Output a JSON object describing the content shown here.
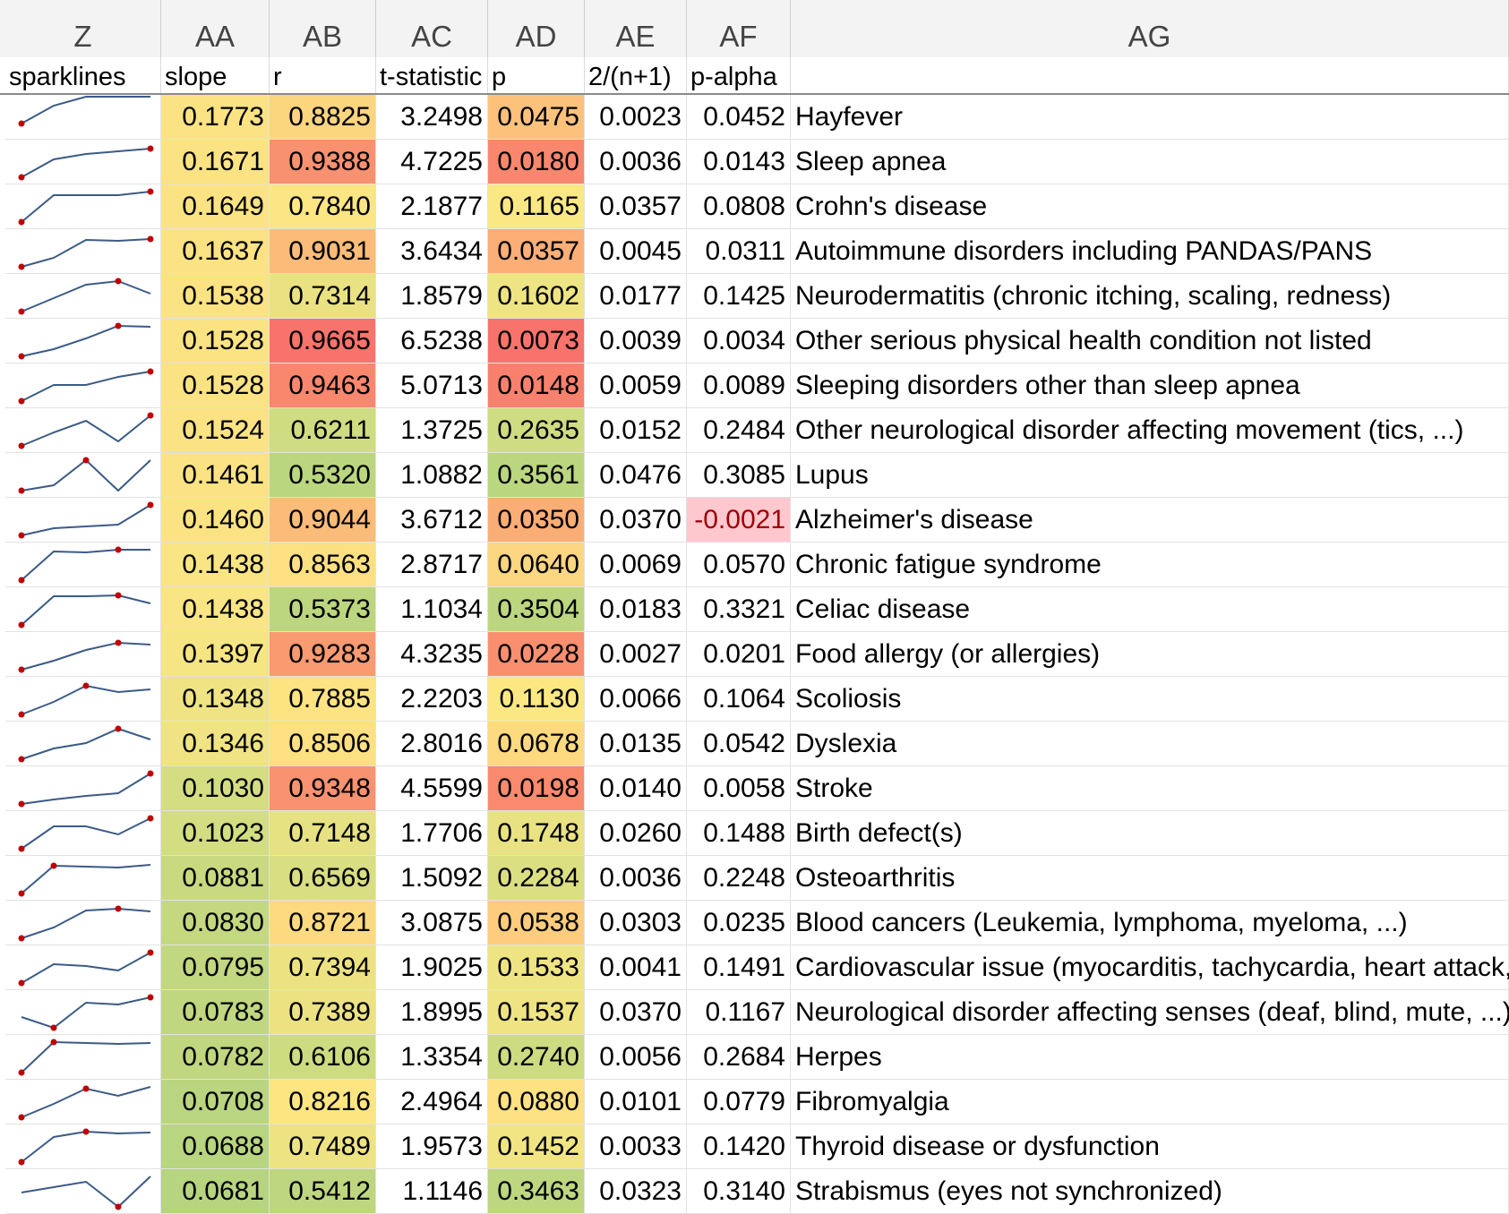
{
  "columns": [
    "Z",
    "AA",
    "AB",
    "AC",
    "AD",
    "AE",
    "AF",
    "AG"
  ],
  "labels": [
    "sparklines",
    "slope",
    "r",
    "t-statistic",
    "p",
    "2/(n+1)",
    "p-alpha",
    ""
  ],
  "sparkline_color": "#3b5b86",
  "marker_color": "#c00000",
  "rows": [
    {
      "slope": "0.1773",
      "r": "0.8825",
      "t": "3.2498",
      "p": "0.0475",
      "e": "0.0023",
      "pa": "0.0452",
      "name": "Hayfever",
      "slope_bg": "#fbe383",
      "r_bg": "#fcd57f",
      "p_bg": "#fcc27b",
      "pa_bg": "",
      "spark": [
        1,
        3,
        4,
        4,
        4
      ],
      "marks": [
        0
      ]
    },
    {
      "slope": "0.1671",
      "r": "0.9388",
      "t": "4.7225",
      "p": "0.0180",
      "e": "0.0036",
      "pa": "0.0143",
      "name": "Sleep apnea",
      "slope_bg": "#fbe383",
      "r_bg": "#f8916f",
      "p_bg": "#f8876e",
      "pa_bg": "",
      "spark": [
        0,
        2,
        2.6,
        2.9,
        3.2
      ],
      "marks": [
        0,
        4
      ]
    },
    {
      "slope": "0.1649",
      "r": "0.7840",
      "t": "2.1877",
      "p": "0.1165",
      "e": "0.0357",
      "pa": "0.0808",
      "name": "Crohn's disease",
      "slope_bg": "#fbe383",
      "r_bg": "#fce583",
      "p_bg": "#fae884",
      "pa_bg": "",
      "spark": [
        0,
        3,
        3,
        3,
        3.4
      ],
      "marks": [
        0,
        4
      ]
    },
    {
      "slope": "0.1637",
      "r": "0.9031",
      "t": "3.6434",
      "p": "0.0357",
      "e": "0.0045",
      "pa": "0.0311",
      "name": "Autoimmune disorders including PANDAS/PANS",
      "slope_bg": "#fbe383",
      "r_bg": "#fbbc79",
      "p_bg": "#fbae76",
      "pa_bg": "",
      "spark": [
        0,
        1,
        3,
        2.9,
        3.1
      ],
      "marks": [
        0,
        4
      ]
    },
    {
      "slope": "0.1538",
      "r": "0.7314",
      "t": "1.8579",
      "p": "0.1602",
      "e": "0.0177",
      "pa": "0.1425",
      "name": "Neurodermatitis (chronic itching, scaling, redness)",
      "slope_bg": "#fbe383",
      "r_bg": "#eae282",
      "p_bg": "#eee483",
      "pa_bg": "",
      "spark": [
        0,
        1.5,
        3,
        3.4,
        2
      ],
      "marks": [
        0,
        3
      ]
    },
    {
      "slope": "0.1528",
      "r": "0.9665",
      "t": "6.5238",
      "p": "0.0073",
      "e": "0.0039",
      "pa": "0.0034",
      "name": "Other serious physical health condition not listed",
      "slope_bg": "#fbe383",
      "r_bg": "#f8736b",
      "p_bg": "#f8736b",
      "pa_bg": "",
      "spark": [
        0,
        0.8,
        2,
        3.4,
        3.3
      ],
      "marks": [
        0,
        3
      ]
    },
    {
      "slope": "0.1528",
      "r": "0.9463",
      "t": "5.0713",
      "p": "0.0148",
      "e": "0.0059",
      "pa": "0.0089",
      "name": "Sleeping disorders other than sleep apnea",
      "slope_bg": "#fbe383",
      "r_bg": "#f8876e",
      "p_bg": "#f8816d",
      "pa_bg": "",
      "spark": [
        0,
        1.8,
        1.8,
        2.7,
        3.3
      ],
      "marks": [
        0,
        4
      ]
    },
    {
      "slope": "0.1524",
      "r": "0.6211",
      "t": "1.3725",
      "p": "0.2635",
      "e": "0.0152",
      "pa": "0.2484",
      "name": "Other neurological disorder affecting movement (tics, ...)",
      "slope_bg": "#fbe383",
      "r_bg": "#cfdc81",
      "p_bg": "#d0dc81",
      "pa_bg": "",
      "spark": [
        0,
        1.5,
        2.8,
        0.5,
        3.4
      ],
      "marks": [
        0,
        4
      ]
    },
    {
      "slope": "0.1461",
      "r": "0.5320",
      "t": "1.0882",
      "p": "0.3561",
      "e": "0.0476",
      "pa": "0.3085",
      "name": "Lupus",
      "slope_bg": "#fbe383",
      "r_bg": "#bad67f",
      "p_bg": "#bad67f",
      "pa_bg": "",
      "spark": [
        0,
        0.6,
        3.4,
        0,
        3.4
      ],
      "marks": [
        0,
        2
      ]
    },
    {
      "slope": "0.1460",
      "r": "0.9044",
      "t": "3.6712",
      "p": "0.0350",
      "e": "0.0370",
      "pa": "-0.0021",
      "name": "Alzheimer's disease",
      "slope_bg": "#fbe383",
      "r_bg": "#fbbc79",
      "p_bg": "#fbad76",
      "pa_bg": "#ffc7ce",
      "spark": [
        0,
        0.8,
        1,
        1.2,
        3.4
      ],
      "marks": [
        0,
        4
      ]
    },
    {
      "slope": "0.1438",
      "r": "0.8563",
      "t": "2.8717",
      "p": "0.0640",
      "e": "0.0069",
      "pa": "0.0570",
      "name": "Chronic fatigue syndrome",
      "slope_bg": "#f9e583",
      "r_bg": "#fde081",
      "p_bg": "#fcd680",
      "pa_bg": "",
      "spark": [
        0,
        3.2,
        3.1,
        3.4,
        3.4
      ],
      "marks": [
        0,
        3
      ]
    },
    {
      "slope": "0.1438",
      "r": "0.5373",
      "t": "1.1034",
      "p": "0.3504",
      "e": "0.0183",
      "pa": "0.3321",
      "name": "Celiac disease",
      "slope_bg": "#f9e583",
      "r_bg": "#bcd67f",
      "p_bg": "#bcd67f",
      "pa_bg": "",
      "spark": [
        0,
        3.2,
        3.2,
        3.3,
        2.4
      ],
      "marks": [
        0,
        3
      ]
    },
    {
      "slope": "0.1397",
      "r": "0.9283",
      "t": "4.3235",
      "p": "0.0228",
      "e": "0.0027",
      "pa": "0.0201",
      "name": "Food allergy (or allergies)",
      "slope_bg": "#f6e583",
      "r_bg": "#f99a71",
      "p_bg": "#f98f6f",
      "pa_bg": "",
      "spark": [
        0,
        1,
        2.2,
        3,
        2.8
      ],
      "marks": [
        0,
        3
      ]
    },
    {
      "slope": "0.1348",
      "r": "0.7885",
      "t": "2.2203",
      "p": "0.1130",
      "e": "0.0066",
      "pa": "0.1064",
      "name": "Scoliosis",
      "slope_bg": "#efe383",
      "r_bg": "#fde382",
      "p_bg": "#fbe883",
      "pa_bg": "",
      "spark": [
        0,
        1.4,
        3.2,
        2.5,
        2.8
      ],
      "marks": [
        0,
        2
      ]
    },
    {
      "slope": "0.1346",
      "r": "0.8506",
      "t": "2.8016",
      "p": "0.0678",
      "e": "0.0135",
      "pa": "0.0542",
      "name": "Dyslexia",
      "slope_bg": "#efe383",
      "r_bg": "#fde081",
      "p_bg": "#fdd97f",
      "pa_bg": "",
      "spark": [
        0,
        1.2,
        1.8,
        3.4,
        2.2
      ],
      "marks": [
        0,
        3
      ]
    },
    {
      "slope": "0.1030",
      "r": "0.9348",
      "t": "4.5599",
      "p": "0.0198",
      "e": "0.0140",
      "pa": "0.0058",
      "name": "Stroke",
      "slope_bg": "#d4dd81",
      "r_bg": "#f99270",
      "p_bg": "#f98a6e",
      "pa_bg": "",
      "spark": [
        0,
        0.5,
        0.9,
        1.2,
        3.4
      ],
      "marks": [
        0,
        4
      ]
    },
    {
      "slope": "0.1023",
      "r": "0.7148",
      "t": "1.7706",
      "p": "0.1748",
      "e": "0.0260",
      "pa": "0.1488",
      "name": "Birth defect(s)",
      "slope_bg": "#d3dd81",
      "r_bg": "#e6e182",
      "p_bg": "#e8e283",
      "pa_bg": "",
      "spark": [
        0,
        2.5,
        2.5,
        1.6,
        3.4
      ],
      "marks": [
        0,
        4
      ]
    },
    {
      "slope": "0.0881",
      "r": "0.6569",
      "t": "1.5092",
      "p": "0.2284",
      "e": "0.0036",
      "pa": "0.2248",
      "name": "Osteoarthritis",
      "slope_bg": "#c8d980",
      "r_bg": "#d8de81",
      "p_bg": "#dbdf82",
      "pa_bg": "",
      "spark": [
        0,
        3.1,
        3,
        2.9,
        3.2
      ],
      "marks": [
        0,
        1
      ]
    },
    {
      "slope": "0.0830",
      "r": "0.8721",
      "t": "3.0875",
      "p": "0.0538",
      "e": "0.0303",
      "pa": "0.0235",
      "name": "Blood cancers (Leukemia, lymphoma, myeloma, ...)",
      "slope_bg": "#c4d880",
      "r_bg": "#fdda80",
      "p_bg": "#fdcd7d",
      "pa_bg": "",
      "spark": [
        0,
        1.2,
        3.1,
        3.3,
        3
      ],
      "marks": [
        0,
        3
      ]
    },
    {
      "slope": "0.0795",
      "r": "0.7394",
      "t": "1.9025",
      "p": "0.1533",
      "e": "0.0041",
      "pa": "0.1491",
      "name": "Cardiovascular issue (myocarditis, tachycardia, heart attack, ...)",
      "slope_bg": "#c1d780",
      "r_bg": "#ece282",
      "p_bg": "#efe483",
      "pa_bg": "",
      "spark": [
        0,
        2.1,
        1.9,
        1.4,
        3.4
      ],
      "marks": [
        0,
        4
      ]
    },
    {
      "slope": "0.0783",
      "r": "0.7389",
      "t": "1.8995",
      "p": "0.1537",
      "e": "0.0370",
      "pa": "0.1167",
      "name": "Neurological disorder affecting senses (deaf, blind, mute, ...)",
      "slope_bg": "#c0d77f",
      "r_bg": "#ece282",
      "p_bg": "#efe483",
      "pa_bg": "",
      "spark": [
        1.2,
        0,
        2.8,
        2.6,
        3.4
      ],
      "marks": [
        1,
        4
      ]
    },
    {
      "slope": "0.0782",
      "r": "0.6106",
      "t": "1.3354",
      "p": "0.2740",
      "e": "0.0056",
      "pa": "0.2684",
      "name": "Herpes",
      "slope_bg": "#c0d77f",
      "r_bg": "#cddc81",
      "p_bg": "#cddb81",
      "pa_bg": "",
      "spark": [
        0,
        3.4,
        3.3,
        3.2,
        3.3
      ],
      "marks": [
        0,
        1
      ]
    },
    {
      "slope": "0.0708",
      "r": "0.8216",
      "t": "2.4964",
      "p": "0.0880",
      "e": "0.0101",
      "pa": "0.0779",
      "name": "Fibromyalgia",
      "slope_bg": "#bad57f",
      "r_bg": "#fde582",
      "p_bg": "#fde182",
      "pa_bg": "",
      "spark": [
        0,
        1.5,
        3.2,
        2.4,
        3.4
      ],
      "marks": [
        0,
        2
      ]
    },
    {
      "slope": "0.0688",
      "r": "0.7489",
      "t": "1.9573",
      "p": "0.1452",
      "e": "0.0033",
      "pa": "0.1420",
      "name": "Thyroid disease or dysfunction",
      "slope_bg": "#b8d57f",
      "r_bg": "#eee383",
      "p_bg": "#f1e583",
      "pa_bg": "",
      "spark": [
        0,
        2.8,
        3.4,
        3.2,
        3.3
      ],
      "marks": [
        0,
        2
      ]
    },
    {
      "slope": "0.0681",
      "r": "0.5412",
      "t": "1.1146",
      "p": "0.3463",
      "e": "0.0323",
      "pa": "0.3140",
      "name": "Strabismus (eyes not synchronized)",
      "slope_bg": "#b7d47f",
      "r_bg": "#bed680",
      "p_bg": "#bdd680",
      "pa_bg": "",
      "spark": [
        1.6,
        2.2,
        2.8,
        0,
        3.4
      ],
      "marks": [
        3
      ]
    }
  ]
}
